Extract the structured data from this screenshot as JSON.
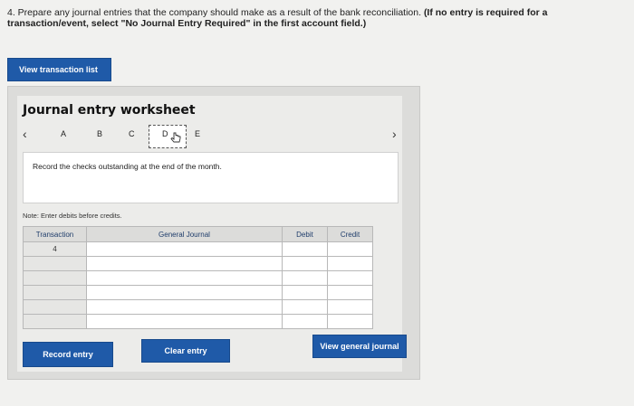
{
  "question": {
    "lead": "4. Prepare any journal entries that the company should make as a result of the bank reconciliation.",
    "instruction": "(If no entry is required for a transaction/event, select \"No Journal Entry Required\" in the first account field.)"
  },
  "buttons": {
    "view_transaction_list": "View transaction list",
    "record_entry": "Record entry",
    "clear_entry": "Clear entry",
    "view_general_journal": "View general journal"
  },
  "worksheet": {
    "title": "Journal entry worksheet",
    "tabs": [
      "A",
      "B",
      "C",
      "D",
      "E"
    ],
    "active_tab": "D",
    "description": "Record the checks outstanding at the end of the month.",
    "note": "Note: Enter debits before credits."
  },
  "table": {
    "headers": [
      "Transaction",
      "General Journal",
      "Debit",
      "Credit"
    ],
    "transaction_value": "4"
  },
  "colors": {
    "accent": "#1f5aa8",
    "background": "#f1f1ef"
  },
  "icons": {
    "prev": "chevron-left-icon",
    "next": "chevron-right-icon",
    "cursor": "hand-pointer-icon"
  }
}
